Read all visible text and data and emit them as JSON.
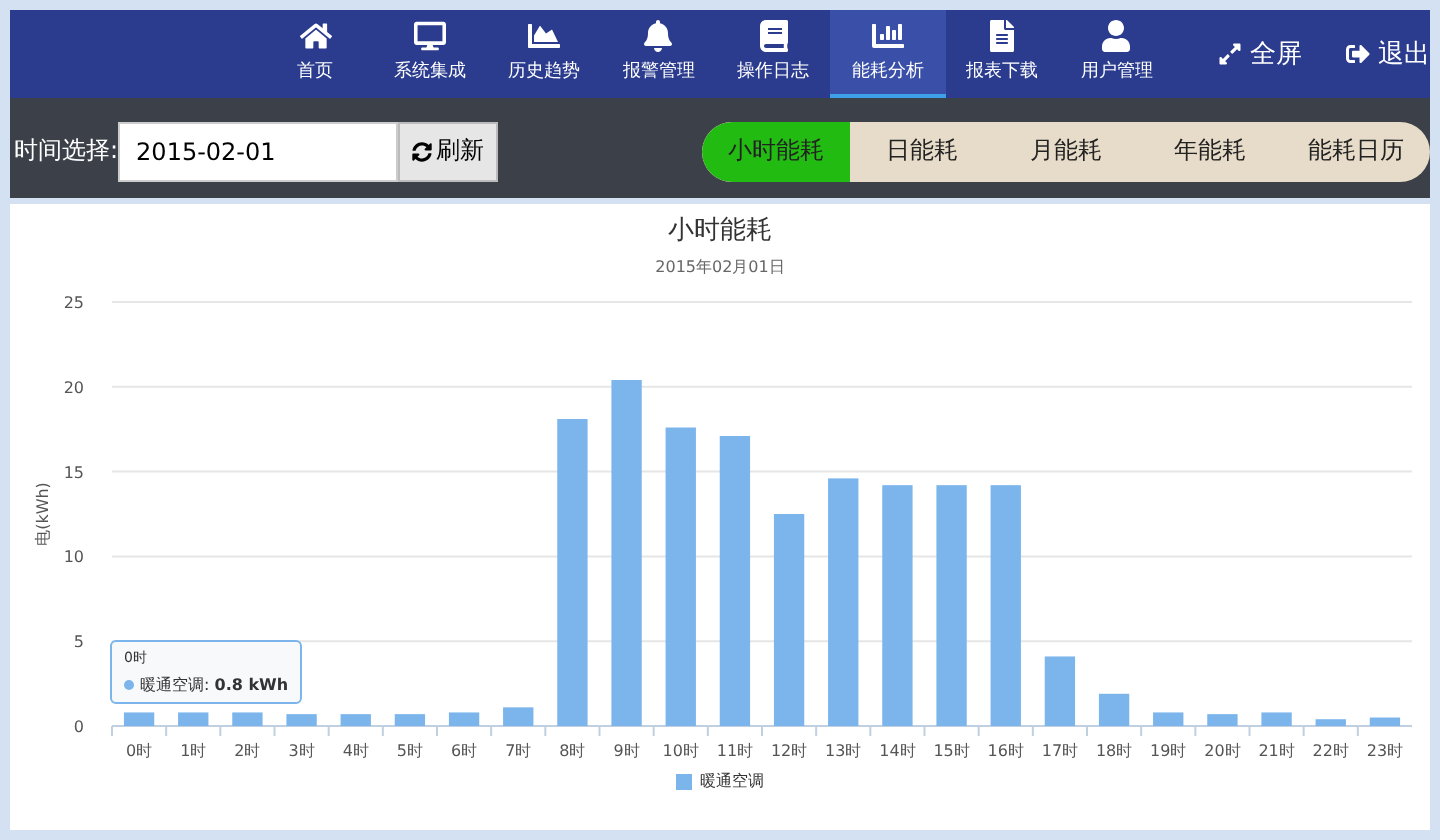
{
  "nav": {
    "items": [
      {
        "label": "首页",
        "selected": false
      },
      {
        "label": "系统集成",
        "selected": false
      },
      {
        "label": "历史趋势",
        "selected": false
      },
      {
        "label": "报警管理",
        "selected": false
      },
      {
        "label": "操作日志",
        "selected": false
      },
      {
        "label": "能耗分析",
        "selected": true
      },
      {
        "label": "报表下载",
        "selected": false
      },
      {
        "label": "用户管理",
        "selected": false
      }
    ],
    "actions": [
      {
        "label": "全屏"
      },
      {
        "label": "退出"
      }
    ]
  },
  "toolbar": {
    "date_label": "时间选择:",
    "date_value": "2015-02-01",
    "refresh": "刷新",
    "tabs": [
      {
        "label": "小时能耗",
        "selected": true
      },
      {
        "label": "日能耗",
        "selected": false
      },
      {
        "label": "月能耗",
        "selected": false
      },
      {
        "label": "年能耗",
        "selected": false
      },
      {
        "label": "能耗日历",
        "selected": false
      }
    ]
  },
  "chart": {
    "tooltip": {
      "title": "0时",
      "text": "暖通空调: **0.8 kWh**"
    },
    "chart_data": {
      "type": "bar",
      "title": "小时能耗",
      "subtitle": "2015年02月01日",
      "ylabel": "电(kWh)",
      "categories": [
        "0时",
        "1时",
        "2时",
        "3时",
        "4时",
        "5时",
        "6时",
        "7时",
        "8时",
        "9时",
        "10时",
        "11时",
        "12时",
        "13时",
        "14时",
        "15时",
        "16时",
        "17时",
        "18时",
        "19时",
        "20时",
        "21时",
        "22时",
        "23时"
      ],
      "series": [
        {
          "name": "暖通空调",
          "color": "#7cb5ec",
          "values": [
            0.8,
            0.8,
            0.8,
            0.7,
            0.7,
            0.7,
            0.8,
            1.1,
            18.1,
            20.4,
            17.6,
            17.1,
            12.5,
            14.6,
            14.2,
            14.2,
            14.2,
            4.1,
            1.9,
            0.8,
            0.7,
            0.8,
            0.4,
            0.5
          ]
        }
      ],
      "ylim": [
        0,
        25
      ],
      "grid": true,
      "yticks": [
        0,
        5,
        10,
        15,
        20,
        25
      ]
    }
  }
}
